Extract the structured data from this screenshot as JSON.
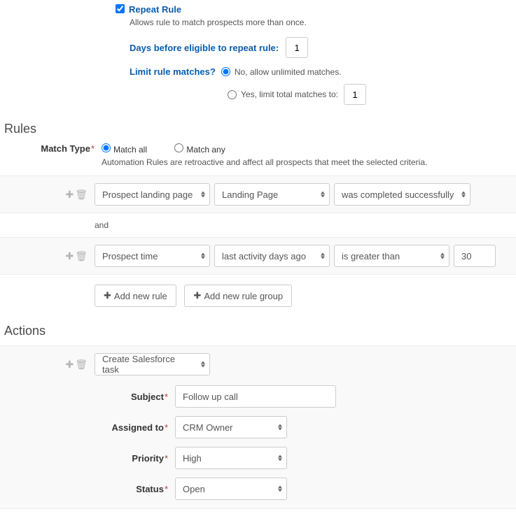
{
  "repeat": {
    "title": "Repeat Rule",
    "desc": "Allows rule to match prospects more than once.",
    "daysLabel": "Days before eligible to repeat rule:",
    "daysValue": "1",
    "limitLabel": "Limit rule matches?",
    "opt1": "No, allow unlimited matches.",
    "opt2": "Yes, limit total matches to:",
    "limitValue": "1"
  },
  "rulesHeading": "Rules",
  "matchType": {
    "label": "Match Type",
    "opt1": "Match all",
    "opt2": "Match any",
    "help": "Automation Rules are retroactive and affect all prospects that meet the selected criteria."
  },
  "rules": [
    {
      "field": "Prospect landing page",
      "sub": "Landing Page",
      "op": "was completed successfully"
    },
    {
      "field": "Prospect time",
      "sub": "last activity days ago",
      "op": "is greater than",
      "val": "30"
    }
  ],
  "andLabel": "and",
  "buttons": {
    "addRule": "Add new rule",
    "addGroup": "Add new rule group"
  },
  "actionsHeading": "Actions",
  "action": {
    "type": "Create Salesforce task",
    "subjectLabel": "Subject",
    "subjectValue": "Follow up call",
    "assignedLabel": "Assigned to",
    "assignedValue": "CRM Owner",
    "priorityLabel": "Priority",
    "priorityValue": "High",
    "statusLabel": "Status",
    "statusValue": "Open"
  }
}
